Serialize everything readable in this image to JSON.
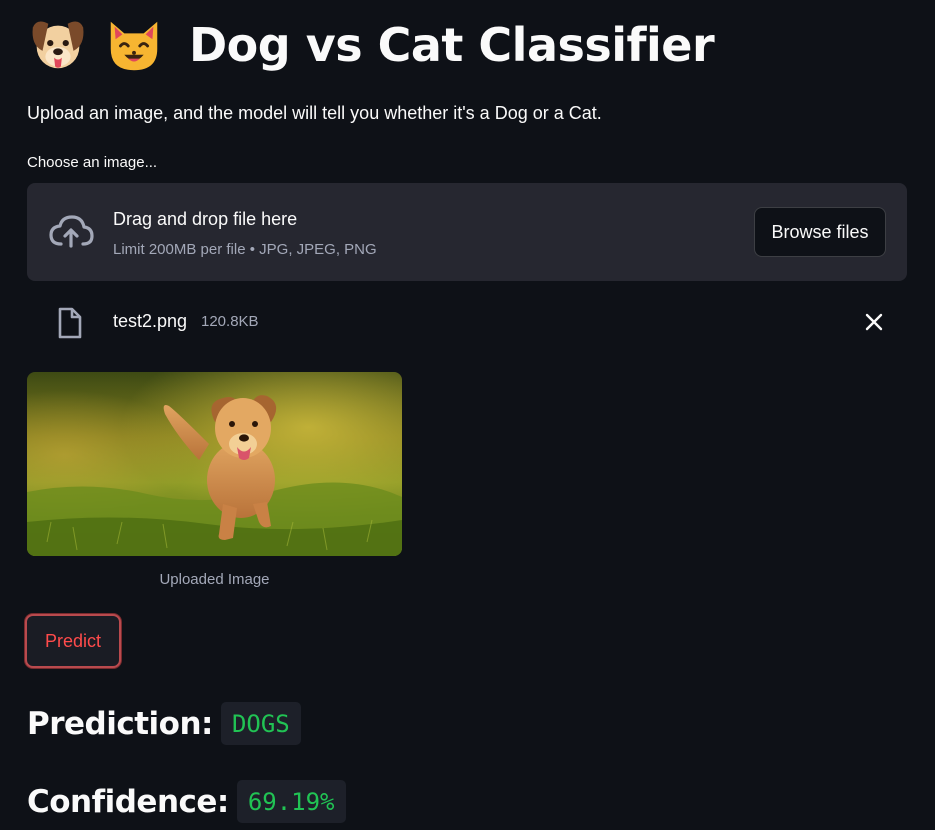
{
  "header": {
    "icons": [
      "dog-face-emoji",
      "cat-face-emoji"
    ],
    "title": "Dog vs Cat Classifier",
    "subtitle": "Upload an image, and the model will tell you whether it's a Dog or a Cat."
  },
  "uploader": {
    "label": "Choose an image...",
    "drop_text": "Drag and drop file here",
    "limit_text": "Limit 200MB per file • JPG, JPEG, PNG",
    "browse_label": "Browse files",
    "file": {
      "name": "test2.png",
      "size": "120.8KB"
    }
  },
  "image": {
    "caption": "Uploaded Image",
    "content": "golden-retriever-running-in-grass"
  },
  "actions": {
    "predict_label": "Predict"
  },
  "results": {
    "prediction_label": "Prediction:",
    "prediction_value": "DOGS",
    "confidence_label": "Confidence:",
    "confidence_value": "69.19%"
  },
  "colors": {
    "background": "#0e1117",
    "surface": "#262730",
    "text": "#fafafa",
    "muted": "#a3a8b8",
    "accent_red": "#ff4b4b",
    "success_green": "#21c354"
  }
}
